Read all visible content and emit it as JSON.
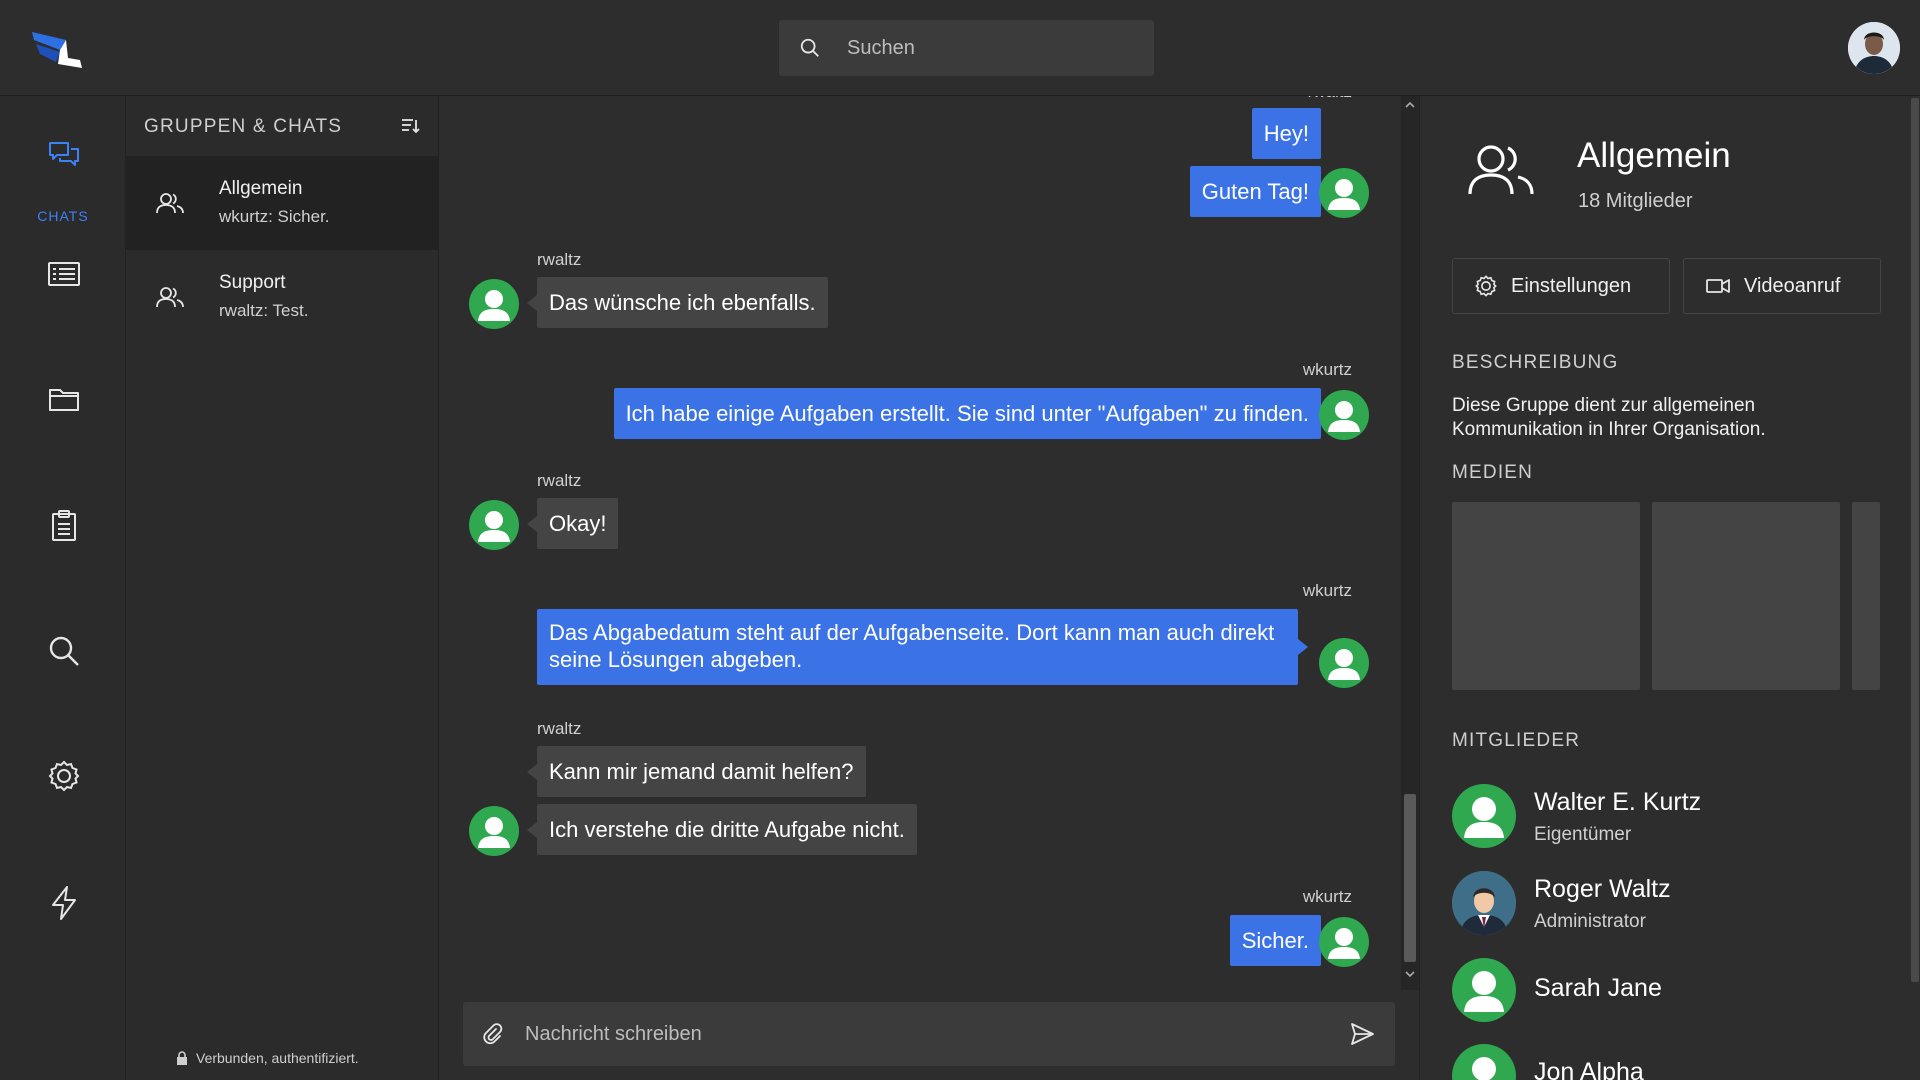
{
  "header": {
    "logo_icon": "app-logo",
    "search": {
      "placeholder": "Suchen",
      "value": "",
      "icon": "search-icon"
    },
    "profile": {
      "icon": "user-avatar"
    }
  },
  "rail": {
    "active_color": "#3b82f6",
    "items": [
      {
        "icon": "chats-icon",
        "label": "CHATS",
        "active": true
      },
      {
        "icon": "news-icon",
        "label": ""
      },
      {
        "icon": "folder-icon",
        "label": ""
      },
      {
        "icon": "clipboard-icon",
        "label": ""
      },
      {
        "icon": "search-icon",
        "label": ""
      },
      {
        "icon": "settings-icon",
        "label": ""
      },
      {
        "icon": "lightning-icon",
        "label": ""
      }
    ]
  },
  "chatlist": {
    "title": "GRUPPEN & CHATS",
    "sort_icon": "sort-icon",
    "items": [
      {
        "name": "Allgemein",
        "last": "wkurtz: Sicher.",
        "icon": "group-icon",
        "active": true
      },
      {
        "name": "Support",
        "last": "rwaltz: Test.",
        "icon": "group-icon"
      }
    ],
    "status": "Verbunden, authentifiziert.",
    "status_icon": "lock-icon"
  },
  "conversation": {
    "partial_sender": "rwaltz",
    "messages": [
      {
        "sender": "",
        "text": "Hey!",
        "dir": "out"
      },
      {
        "sender": "",
        "text": "Guten Tag!",
        "dir": "out"
      },
      {
        "sender": "rwaltz",
        "text": "Das wünsche ich ebenfalls.",
        "dir": "in"
      },
      {
        "sender": "wkurtz",
        "text": "Ich habe einige Aufgaben erstellt. Sie sind unter \"Aufgaben\" zu finden.",
        "dir": "out"
      },
      {
        "sender": "rwaltz",
        "text": "Okay!",
        "dir": "in"
      },
      {
        "sender": "wkurtz",
        "text": "Das Abgabedatum steht auf der Aufgabenseite. Dort kann man auch direkt seine Lösungen abgeben.",
        "dir": "out"
      },
      {
        "sender": "rwaltz",
        "text": "Kann mir jemand damit helfen?",
        "dir": "in"
      },
      {
        "sender": "",
        "text": "Ich verstehe die dritte Aufgabe nicht.",
        "dir": "in"
      },
      {
        "sender": "wkurtz",
        "text": "Sicher.",
        "dir": "out"
      }
    ],
    "incoming_color": "#444444",
    "outgoing_color": "#3b73e6",
    "avatar_color": "#2fa84f"
  },
  "composer": {
    "placeholder": "Nachricht schreiben",
    "value": "",
    "attach_icon": "paperclip-icon",
    "send_icon": "send-icon"
  },
  "details": {
    "group_icon": "group-icon",
    "name": "Allgemein",
    "members_count": "18 Mitglieder",
    "buttons": [
      {
        "label": "Einstellungen",
        "icon": "settings-icon"
      },
      {
        "label": "Videoanruf",
        "icon": "video-icon"
      }
    ],
    "description_title": "BESCHREIBUNG",
    "description": "Diese Gruppe dient zur allgemeinen Kommunikation in Ihrer Organisation.",
    "media_title": "MEDIEN",
    "members_title": "MITGLIEDER",
    "members": [
      {
        "name": "Walter E. Kurtz",
        "role": "Eigentümer",
        "avatar": "default-avatar"
      },
      {
        "name": "Roger Waltz",
        "role": "Administrator",
        "avatar": "photo-avatar"
      },
      {
        "name": "Sarah Jane",
        "role": "",
        "avatar": "default-avatar"
      },
      {
        "name": "Jon Alpha",
        "role": "",
        "avatar": "default-avatar"
      }
    ]
  }
}
